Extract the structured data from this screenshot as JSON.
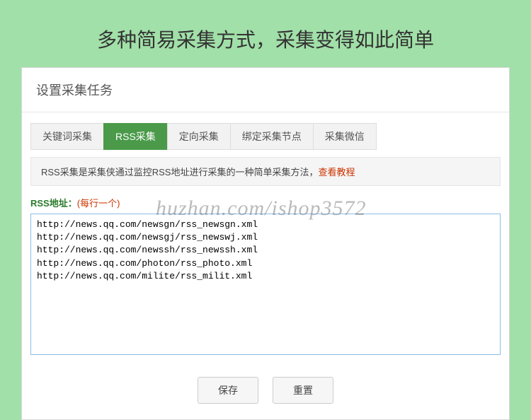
{
  "pageTitle": "多种简易采集方式，采集变得如此简单",
  "panel": {
    "header": "设置采集任务"
  },
  "tabs": [
    {
      "label": "关键词采集",
      "active": false
    },
    {
      "label": "RSS采集",
      "active": true
    },
    {
      "label": "定向采集",
      "active": false
    },
    {
      "label": "绑定采集节点",
      "active": false
    },
    {
      "label": "采集微信",
      "active": false
    }
  ],
  "infoBar": {
    "text": "RSS采集是采集侠通过监控RSS地址进行采集的一种简单采集方法，",
    "linkText": "查看教程"
  },
  "form": {
    "label": "RSS地址：",
    "hint": "(每行一个)",
    "textareaValue": "http://news.qq.com/newsgn/rss_newsgn.xml\nhttp://news.qq.com/newsgj/rss_newswj.xml\nhttp://news.qq.com/newssh/rss_newssh.xml\nhttp://news.qq.com/photon/rss_photo.xml\nhttp://news.qq.com/milite/rss_milit.xml"
  },
  "buttons": {
    "save": "保存",
    "reset": "重置"
  },
  "watermark": "huzhan.com/ishop3572"
}
